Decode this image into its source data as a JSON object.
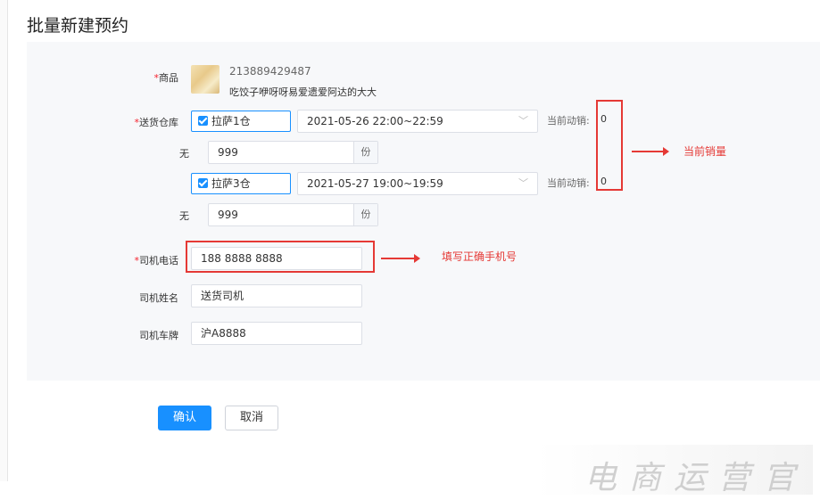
{
  "page": {
    "title": "批量新建预约"
  },
  "form": {
    "product": {
      "label": "商品",
      "required_mark": "*",
      "id": "213889429487",
      "name": "吃饺子咿呀呀易爱遗爱阿达的大大"
    },
    "warehouse": {
      "label": "送货仓库",
      "required_mark": "*",
      "rows": [
        {
          "name": "拉萨1仓",
          "time": "2021-05-26 22:00~22:59",
          "sales_label": "当前动销:",
          "sales_value": "0",
          "none_label": "无",
          "qty": "999",
          "unit": "份"
        },
        {
          "name": "拉萨3仓",
          "time": "2021-05-27 19:00~19:59",
          "sales_label": "当前动销:",
          "sales_value": "0",
          "none_label": "无",
          "qty": "999",
          "unit": "份"
        }
      ]
    },
    "driver_phone": {
      "label": "司机电话",
      "required_mark": "*",
      "value": "188 8888 8888"
    },
    "driver_name": {
      "label": "司机姓名",
      "value": "送货司机"
    },
    "plate": {
      "label": "司机车牌",
      "value": "沪A8888"
    }
  },
  "annotations": {
    "sales": "当前销量",
    "phone": "填写正确手机号"
  },
  "buttons": {
    "confirm": "确认",
    "cancel": "取消"
  },
  "watermark": "电商运营官",
  "colors": {
    "primary": "#1890ff",
    "annotation": "#e53935",
    "panel": "#f7f8fa"
  }
}
